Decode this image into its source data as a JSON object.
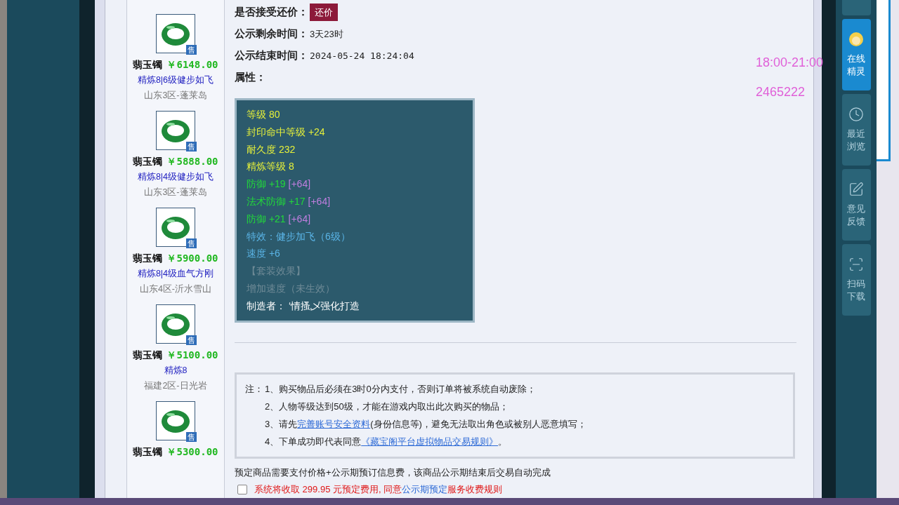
{
  "listings": [
    {
      "name": "翡玉镯",
      "price": "￥6148.00",
      "badge": "售",
      "tags": "精炼8|6级健步如飞",
      "server": "山东3区-蓬莱岛"
    },
    {
      "name": "翡玉镯",
      "price": "￥5888.00",
      "badge": "售",
      "tags": "精炼8|4级健步如飞",
      "server": "山东3区-蓬莱岛"
    },
    {
      "name": "翡玉镯",
      "price": "￥5900.00",
      "badge": "售",
      "tags": "精炼8|4级血气方刚",
      "server": "山东4区-沂水雪山"
    },
    {
      "name": "翡玉镯",
      "price": "￥5100.00",
      "badge": "售",
      "tags": "精炼8",
      "server": "福建2区-日光岩"
    },
    {
      "name": "翡玉镯",
      "price": "￥5300.00",
      "badge": "售"
    }
  ],
  "info": [
    {
      "label": "是否接受还价：",
      "kind": "button",
      "value": "还价"
    },
    {
      "label": "公示剩余时间：",
      "kind": "text",
      "value": "3天23时"
    },
    {
      "label": "公示结束时间：",
      "kind": "mono",
      "value": "2024-05-24 18:24:04"
    },
    {
      "label": "属性：",
      "kind": "none"
    }
  ],
  "attributes": [
    {
      "kind": "base",
      "text": "等级 80"
    },
    {
      "kind": "base",
      "text": "封印命中等级 +24"
    },
    {
      "kind": "base",
      "text": "耐久度 232"
    },
    {
      "kind": "base",
      "text": "精炼等级 8"
    },
    {
      "kind": "bonus",
      "text": "防御 +19",
      "extra": "[+64]"
    },
    {
      "kind": "bonus",
      "text": "法术防御 +17",
      "extra": "[+64]"
    },
    {
      "kind": "bonus",
      "text": "防御 +21",
      "extra": "[+64]"
    },
    {
      "kind": "effect",
      "text": "特效：健步加飞（6级）"
    },
    {
      "kind": "effect",
      "text": "速度 +6"
    },
    {
      "kind": "suit",
      "text": "【套装效果】"
    },
    {
      "kind": "suit",
      "text": "增加速度（未生效）"
    },
    {
      "kind": "maker",
      "text": "制造者： ‘情搔乄强化打造"
    }
  ],
  "notes": {
    "prefix": "注：",
    "items": [
      {
        "number": "1、",
        "parts": [
          {
            "text": "购买物品后必须在3时0分内支付，否则订单将被系统自动废除；",
            "link": false
          }
        ]
      },
      {
        "number": "2、",
        "parts": [
          {
            "text": "人物等级达到50级，才能在游戏内取出此次购买的物品；",
            "link": false
          }
        ]
      },
      {
        "number": "3、",
        "parts": [
          {
            "text": "请先",
            "link": false
          },
          {
            "text": "完善账号安全资料",
            "link": true
          },
          {
            "text": "(身份信息等)，避免无法取出角色或被别人恶意填写；",
            "link": false
          }
        ]
      },
      {
        "number": "4、",
        "parts": [
          {
            "text": "下单成功即代表同意",
            "link": false
          },
          {
            "text": "《藏宝阁平台虚拟物品交易规则》",
            "link": true
          },
          {
            "text": "。",
            "link": false
          }
        ]
      }
    ]
  },
  "reserve_note": "预定商品需要支付价格+公示期预订信息费，该商品公示期结束后交易自动完成",
  "agreement": {
    "checked": false,
    "parts": [
      {
        "text": "系统将收取 299.95 元预定费用, 同意",
        "link": false
      },
      {
        "text": "公示期预定",
        "link": true
      },
      {
        "text": "服务收费规则",
        "link": false
      }
    ]
  },
  "overlay": {
    "hours": "18:00-21:00",
    "number": "2465222"
  },
  "sidebar": [
    {
      "kind": "spirit",
      "label": "在线精灵",
      "selected": true
    },
    {
      "kind": "clock",
      "label": "最近浏览",
      "selected": false
    },
    {
      "kind": "edit",
      "label": "意见反馈",
      "selected": false
    },
    {
      "kind": "scan",
      "label": "扫码下载",
      "selected": false
    }
  ]
}
